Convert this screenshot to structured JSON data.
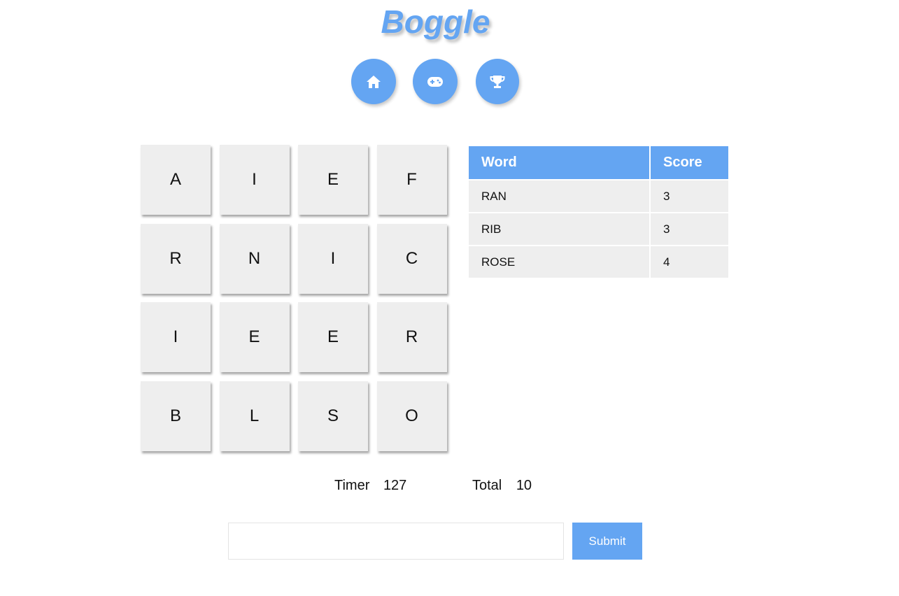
{
  "header": {
    "title": "Boggle",
    "nav": [
      {
        "icon": "home-icon"
      },
      {
        "icon": "gamepad-icon"
      },
      {
        "icon": "trophy-icon"
      }
    ]
  },
  "board": {
    "rows": [
      [
        "A",
        "I",
        "E",
        "F"
      ],
      [
        "R",
        "N",
        "I",
        "C"
      ],
      [
        "I",
        "E",
        "E",
        "R"
      ],
      [
        "B",
        "L",
        "S",
        "O"
      ]
    ]
  },
  "words_table": {
    "headers": {
      "word": "Word",
      "score": "Score"
    },
    "rows": [
      {
        "word": "RAN",
        "score": "3"
      },
      {
        "word": "RIB",
        "score": "3"
      },
      {
        "word": "ROSE",
        "score": "4"
      }
    ]
  },
  "stats": {
    "timer_label": "Timer",
    "timer_value": "127",
    "total_label": "Total",
    "total_value": "10"
  },
  "input": {
    "value": "",
    "placeholder": "",
    "submit_label": "Submit"
  },
  "colors": {
    "accent": "#64a5f2",
    "tile": "#eeeeee"
  }
}
